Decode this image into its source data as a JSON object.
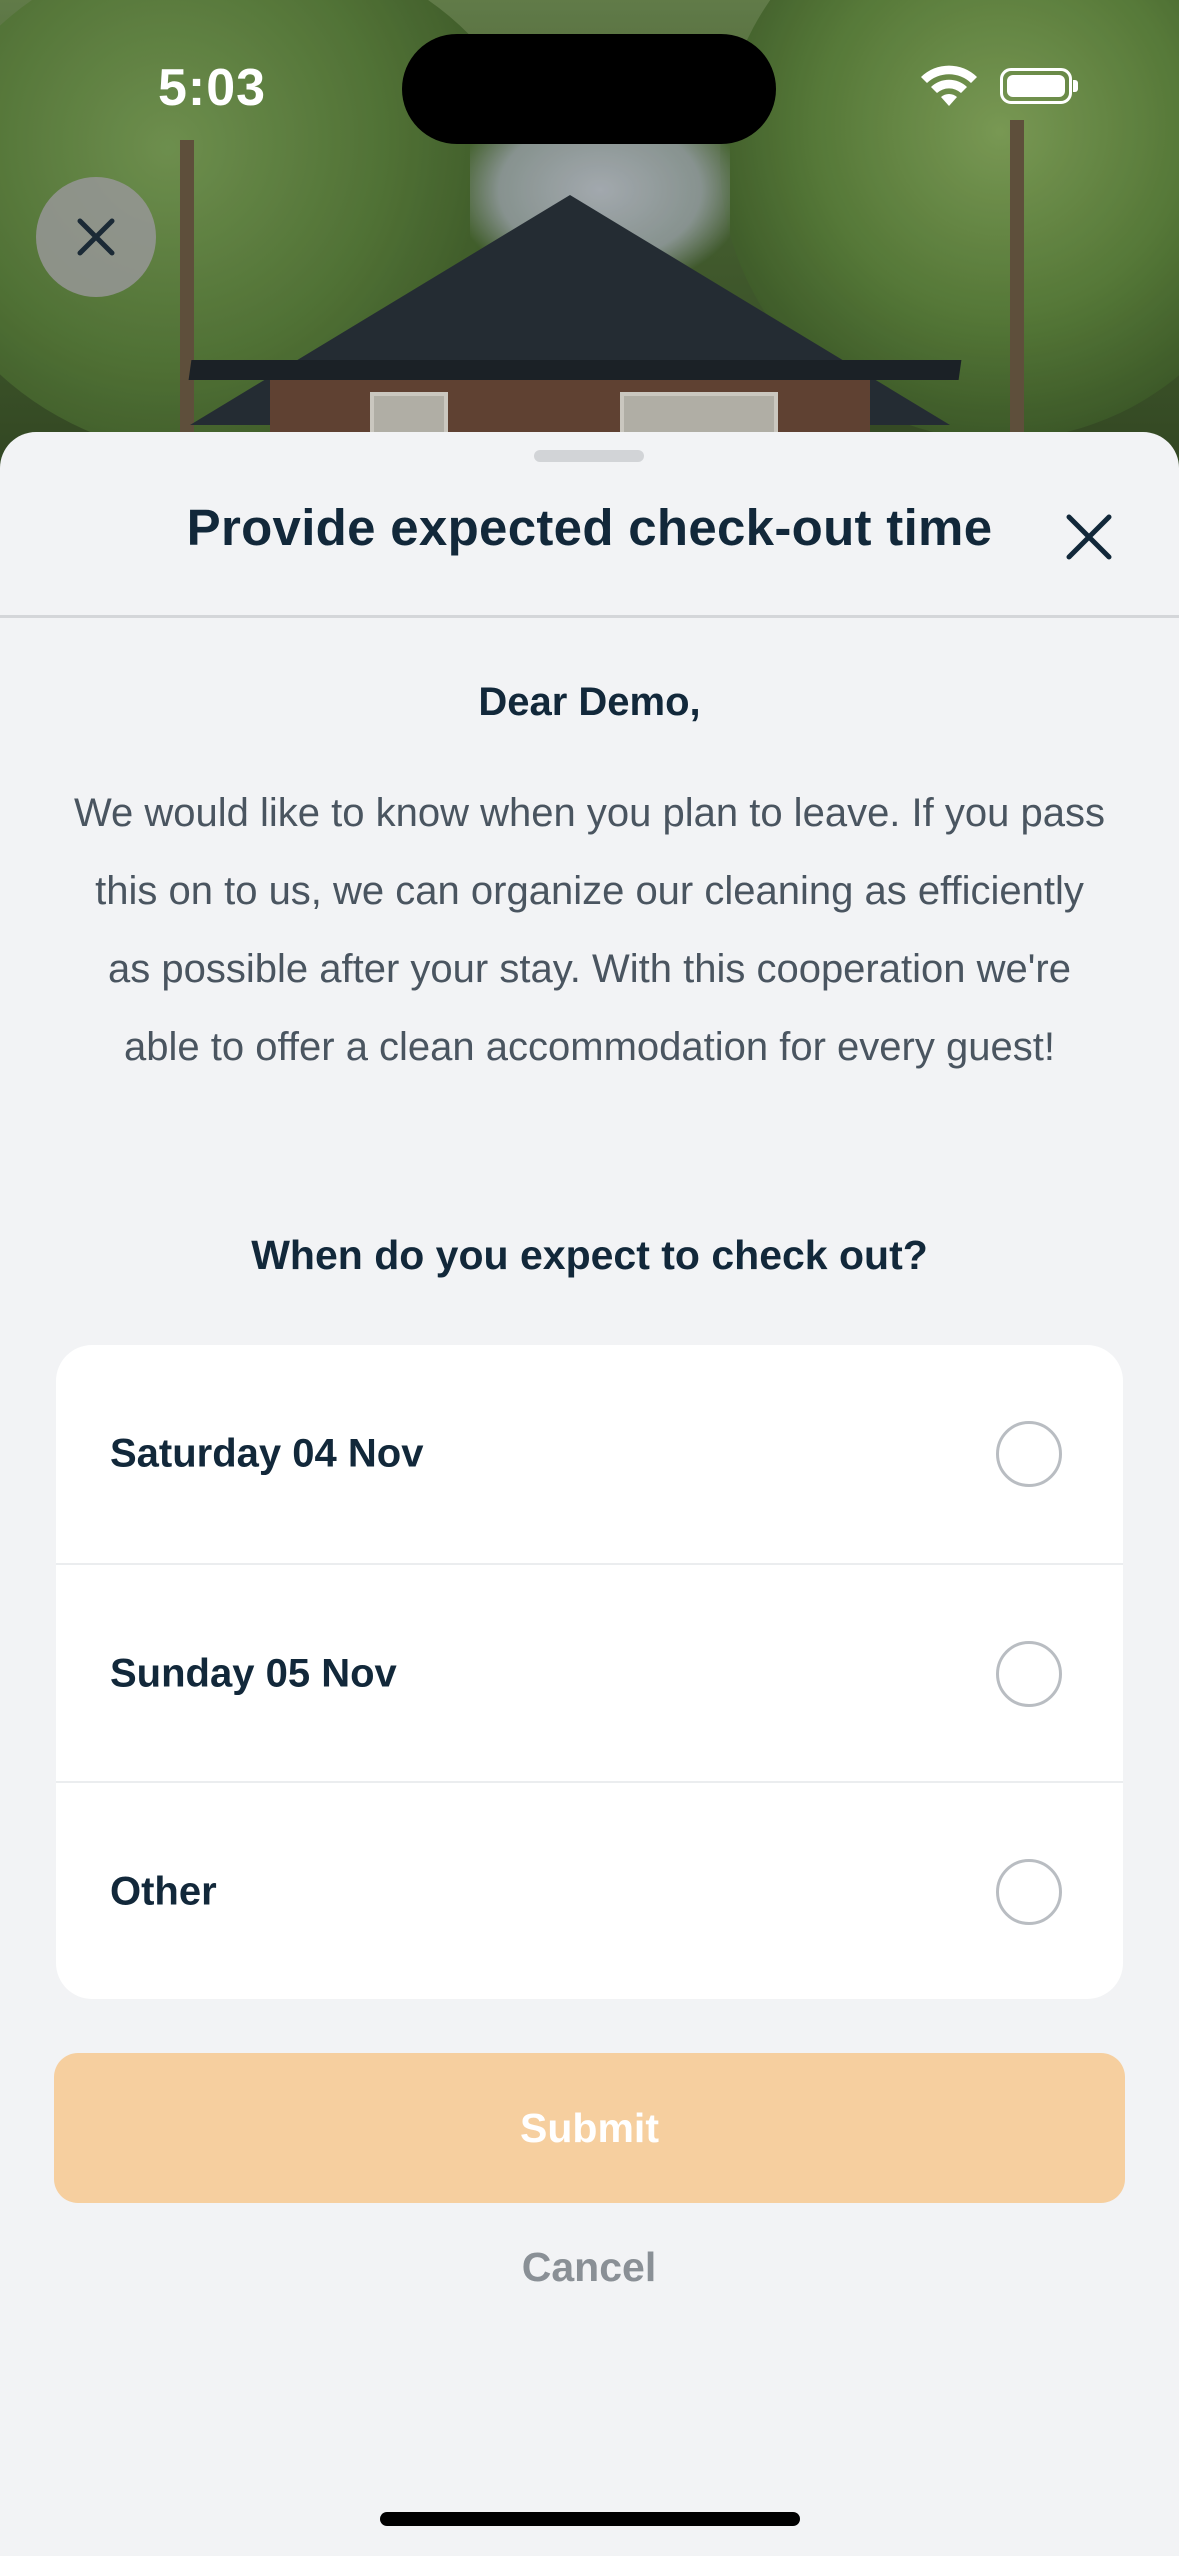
{
  "status_bar": {
    "time": "5:03",
    "wifi_icon": "wifi-icon",
    "battery_icon": "battery-full-icon"
  },
  "hero": {
    "close_icon": "close-icon"
  },
  "sheet": {
    "title": "Provide expected check-out time",
    "close_icon": "close-icon",
    "greeting": "Dear Demo,",
    "intro": "We would like to know when you plan to leave. If you pass this on to us, we can organize our cleaning as efficiently as possible after your stay. With this cooperation we're able to offer a clean accommodation for every guest!",
    "question": "When do you expect to check out?",
    "options": [
      {
        "label": "Saturday 04 Nov",
        "selected": false
      },
      {
        "label": "Sunday 05 Nov",
        "selected": false
      },
      {
        "label": "Other",
        "selected": false
      }
    ],
    "submit_label": "Submit",
    "cancel_label": "Cancel"
  },
  "colors": {
    "submit_disabled": "#f6cf9f",
    "text_primary": "#12283a",
    "text_secondary": "#4a5560",
    "sheet_background": "#f2f3f5"
  }
}
